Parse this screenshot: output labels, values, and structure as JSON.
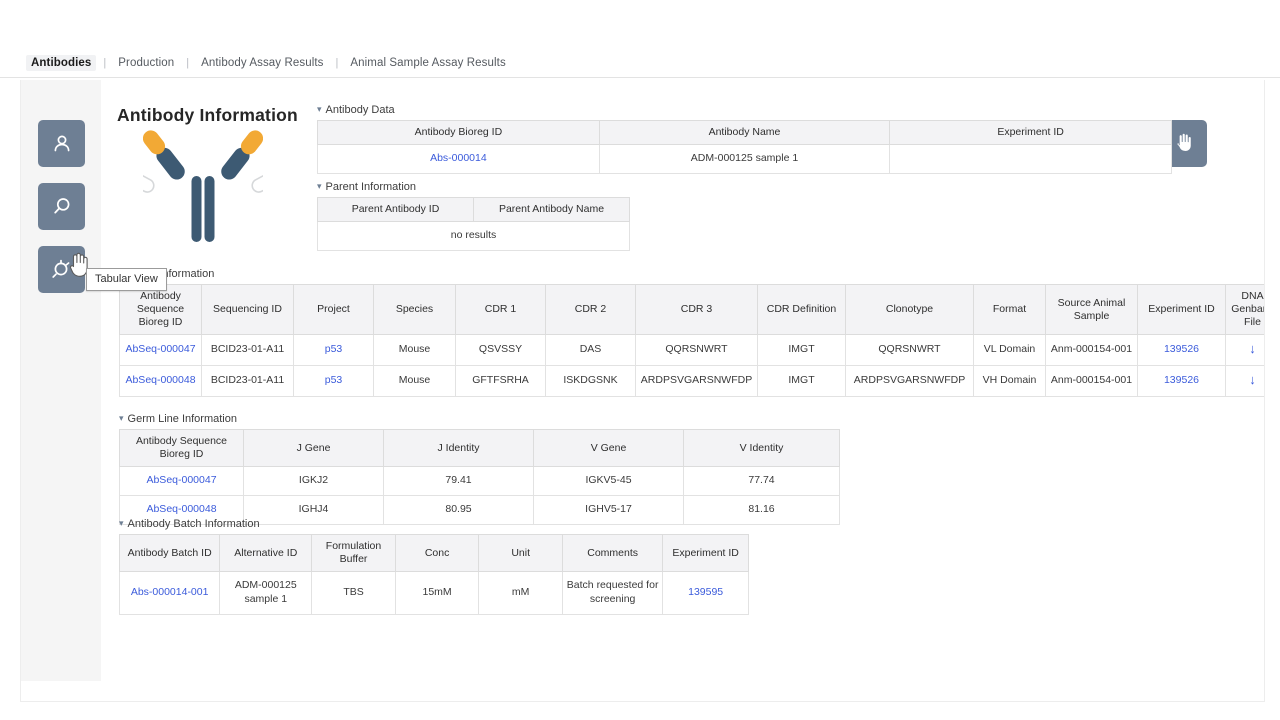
{
  "nav": {
    "items": [
      {
        "label": "Antibodies",
        "active": true
      },
      {
        "label": "Production",
        "active": false
      },
      {
        "label": "Antibody Assay Results",
        "active": false
      },
      {
        "label": "Animal Sample Assay Results",
        "active": false
      }
    ],
    "separator": "|"
  },
  "page": {
    "title": "Antibody Information"
  },
  "rail": {
    "buttons": [
      {
        "icon": "user-icon",
        "name": "user-profile-button"
      },
      {
        "icon": "search-icon",
        "name": "search-button"
      },
      {
        "icon": "tabular-view-icon",
        "name": "tabular-view-button"
      }
    ],
    "tooltip": "Tabular View"
  },
  "pan_button": {
    "icon": "hand-icon",
    "label": "Pan"
  },
  "sections": {
    "antibody_data": {
      "title": "Antibody Data",
      "caret": "▾",
      "columns": [
        "Antibody Bioreg ID",
        "Antibody Name",
        "Experiment ID"
      ],
      "rows": [
        {
          "bioreg_id": "Abs-000014",
          "name": "ADM-000125 sample 1",
          "experiment_id": ""
        }
      ]
    },
    "parent_information": {
      "title": "Parent Information",
      "caret": "▾",
      "columns": [
        "Parent Antibody ID",
        "Parent Antibody Name"
      ],
      "empty_text": "no results"
    },
    "chain_information": {
      "title": "Chain Information",
      "caret": "▾",
      "columns": [
        "Antibody Sequence Bioreg ID",
        "Sequencing ID",
        "Project",
        "Species",
        "CDR 1",
        "CDR 2",
        "CDR 3",
        "CDR Definition",
        "Clonotype",
        "Format",
        "Source Animal Sample",
        "Experiment ID",
        "DNA Genbank File"
      ],
      "rows": [
        {
          "sequence_id": "AbSeq-000047",
          "sequencing_id": "BCID23-01-A11",
          "project": "p53",
          "species": "Mouse",
          "cdr1": "QSVSSY",
          "cdr2": "DAS",
          "cdr3": "QQRSNWRT",
          "cdr_definition": "IMGT",
          "clonotype": "QQRSNWRT",
          "format": "VL Domain",
          "source_animal_sample": "Anm-000154-001",
          "experiment_id": "139526",
          "genbank": "↓"
        },
        {
          "sequence_id": "AbSeq-000048",
          "sequencing_id": "BCID23-01-A11",
          "project": "p53",
          "species": "Mouse",
          "cdr1": "GFTFSRHA",
          "cdr2": "ISKDGSNK",
          "cdr3": "ARDPSVGARSNWFDP",
          "cdr_definition": "IMGT",
          "clonotype": "ARDPSVGARSNWFDP",
          "format": "VH Domain",
          "source_animal_sample": "Anm-000154-001",
          "experiment_id": "139526",
          "genbank": "↓"
        }
      ]
    },
    "germ_line_information": {
      "title": "Germ Line Information",
      "caret": "▾",
      "columns": [
        "Antibody Sequence Bioreg ID",
        "J Gene",
        "J Identity",
        "V Gene",
        "V Identity"
      ],
      "rows": [
        {
          "sequence_id": "AbSeq-000047",
          "j_gene": "IGKJ2",
          "j_identity": "79.41",
          "v_gene": "IGKV5-45",
          "v_identity": "77.74"
        },
        {
          "sequence_id": "AbSeq-000048",
          "j_gene": "IGHJ4",
          "j_identity": "80.95",
          "v_gene": "IGHV5-17",
          "v_identity": "81.16"
        }
      ]
    },
    "antibody_batch_information": {
      "title": "Antibody Batch Information",
      "caret": "▾",
      "columns": [
        "Antibody Batch ID",
        "Alternative ID",
        "Formulation Buffer",
        "Conc",
        "Unit",
        "Comments",
        "Experiment ID"
      ],
      "rows": [
        {
          "batch_id": "Abs-000014-001",
          "alternative_id": "ADM-000125 sample 1",
          "formulation_buffer": "TBS",
          "conc": "15mM",
          "unit": "mM",
          "comments": "Batch requested for screening",
          "experiment_id": "139595"
        }
      ]
    }
  },
  "colors": {
    "accent_button": "#6e7f94",
    "link": "#3b5bdb",
    "header_bg": "#f3f3f5",
    "rail_bg": "#f5f5f5",
    "antibody_body": "#3d5a73",
    "antibody_cap": "#f2a935"
  }
}
